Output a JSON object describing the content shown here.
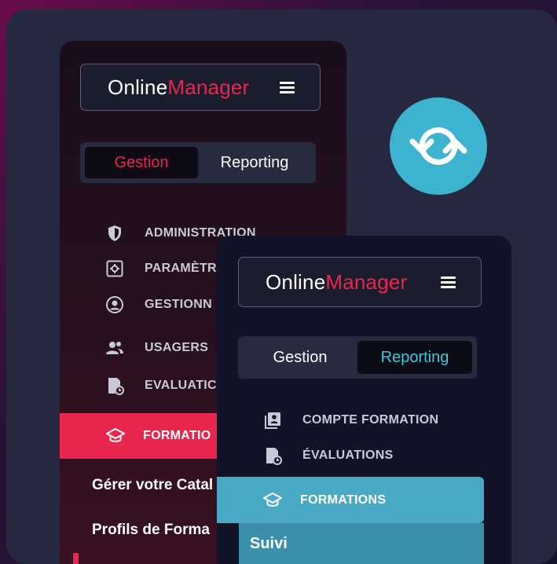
{
  "colors": {
    "accent_red": "#e8264e",
    "accent_teal": "#3cc8dc",
    "teal_highlight": "#4aa9c4",
    "sync_blue": "#3cb3cf"
  },
  "gestion_panel": {
    "logo": {
      "part1": "Online",
      "part2": "Manager"
    },
    "tabs": {
      "gestion": "Gestion",
      "reporting": "Reporting",
      "active": "Gestion"
    },
    "menu": [
      {
        "label": "ADMINISTRATION",
        "icon": "shield-icon"
      },
      {
        "label": "PARAMÈTR",
        "icon": "settings-gear-icon"
      },
      {
        "label": "GESTIONN",
        "icon": "user-circle-icon"
      },
      {
        "label": "USAGERS",
        "icon": "users-icon"
      },
      {
        "label": "EVALUATIC",
        "icon": "evaluation-doc-icon"
      }
    ],
    "active_item": {
      "label": "FORMATIO",
      "icon": "graduation-cap-icon"
    },
    "sub_items": [
      "Gérer votre Catal",
      "Profils de Forma"
    ]
  },
  "reporting_panel": {
    "logo": {
      "part1": "Online",
      "part2": "Manager"
    },
    "tabs": {
      "gestion": "Gestion",
      "reporting": "Reporting",
      "active": "Reporting"
    },
    "menu": [
      {
        "label": "COMPTE FORMATION",
        "icon": "account-book-icon"
      },
      {
        "label": "ÉVALUATIONS",
        "icon": "evaluation-doc-icon"
      }
    ],
    "active_item": {
      "label": "FORMATIONS",
      "icon": "graduation-cap-icon"
    },
    "sub_items": [
      "Suivi"
    ]
  },
  "sync_icon": "sync-arrows-icon"
}
